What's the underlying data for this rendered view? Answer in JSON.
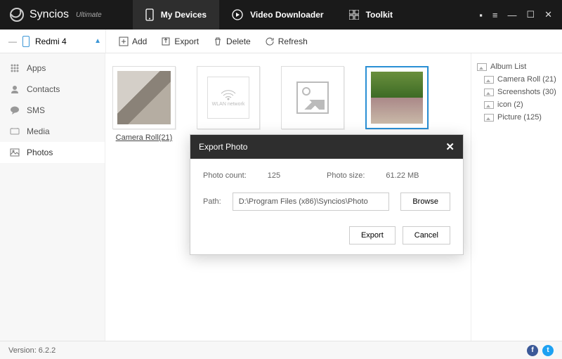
{
  "app": {
    "name": "Syncios",
    "sub": "Ultimate"
  },
  "tabs": {
    "devices": "My Devices",
    "downloader": "Video Downloader",
    "toolkit": "Toolkit"
  },
  "device": {
    "name": "Redmi 4"
  },
  "toolbar": {
    "add": "Add",
    "export": "Export",
    "delete": "Delete",
    "refresh": "Refresh"
  },
  "sidebar": {
    "apps": "Apps",
    "contacts": "Contacts",
    "sms": "SMS",
    "media": "Media",
    "photos": "Photos"
  },
  "albums": {
    "camera": "Camera Roll(21)",
    "screenshots": "Screenshots(30)",
    "icon": "icon(2)",
    "picture": "Picture(125)"
  },
  "right": {
    "title": "Album List",
    "camera": "Camera Roll (21)",
    "screenshots": "Screenshots (30)",
    "icon": "icon (2)",
    "picture": "Picture (125)"
  },
  "dialog": {
    "title": "Export Photo",
    "count_label": "Photo count:",
    "count_value": "125",
    "size_label": "Photo size:",
    "size_value": "61.22 MB",
    "path_label": "Path:",
    "path_value": "D:\\Program Files (x86)\\Syncios\\Photo",
    "browse": "Browse",
    "export": "Export",
    "cancel": "Cancel"
  },
  "footer": {
    "version": "Version: 6.2.2"
  }
}
